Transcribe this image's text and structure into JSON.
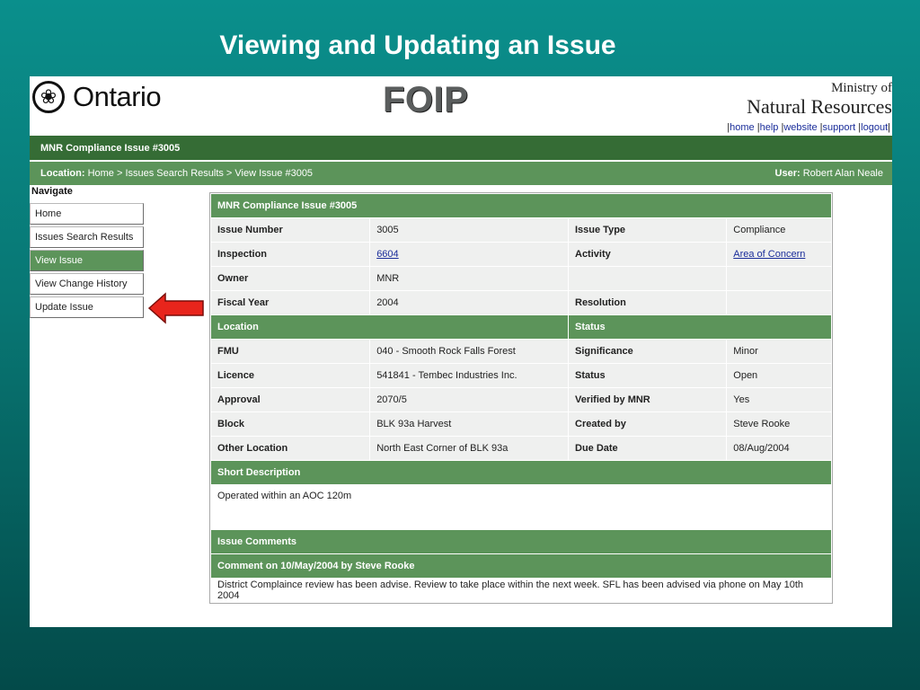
{
  "slide_title": "Viewing and Updating an  Issue",
  "header": {
    "logo_text": "Ontario",
    "app_name": "FOIP",
    "ministry_line1": "Ministry of",
    "ministry_line2": "Natural Resources",
    "links": [
      "home",
      "help",
      "website",
      "support",
      "logout"
    ]
  },
  "title_bar": "MNR Compliance Issue #3005",
  "location_bar": {
    "label": "Location:",
    "path": "Home > Issues Search Results > View Issue #3005",
    "user_label": "User:",
    "user_name": "Robert Alan Neale"
  },
  "nav": {
    "title": "Navigate",
    "items": [
      {
        "label": "Home",
        "active": false
      },
      {
        "label": "Issues Search Results",
        "active": false
      },
      {
        "label": "View Issue",
        "active": true
      },
      {
        "label": "View Change History",
        "active": false
      },
      {
        "label": "Update Issue",
        "active": false
      }
    ]
  },
  "issue": {
    "panel_title": "MNR Compliance Issue #3005",
    "issue_number_label": "Issue Number",
    "issue_number": "3005",
    "issue_type_label": "Issue Type",
    "issue_type": "Compliance",
    "inspection_label": "Inspection",
    "inspection": "6604",
    "activity_label": "Activity",
    "activity": "Area of Concern",
    "owner_label": "Owner",
    "owner": "MNR",
    "fiscal_year_label": "Fiscal Year",
    "fiscal_year": "2004",
    "resolution_label": "Resolution",
    "resolution": "",
    "location_section": "Location",
    "status_section": "Status",
    "fmu_label": "FMU",
    "fmu": "040 - Smooth Rock Falls Forest",
    "significance_label": "Significance",
    "significance": "Minor",
    "licence_label": "Licence",
    "licence": "541841 - Tembec Industries Inc.",
    "status_label": "Status",
    "status": "Open",
    "approval_label": "Approval",
    "approval": "2070/5",
    "verified_label": "Verified by MNR",
    "verified": "Yes",
    "block_label": "Block",
    "block": "BLK 93a Harvest",
    "created_label": "Created by",
    "created": "Steve Rooke",
    "other_location_label": "Other Location",
    "other_location": "North East Corner of BLK 93a",
    "due_date_label": "Due Date",
    "due_date": "08/Aug/2004",
    "short_desc_section": "Short Description",
    "short_desc": "Operated within an AOC 120m",
    "comments_section": "Issue Comments",
    "comment_head": "Comment on 10/May/2004 by Steve Rooke",
    "comment_text": "District Complaince review has been advise. Review to take place within the next week. SFL has been advised via phone on May 10th 2004"
  },
  "colors": {
    "dark_green": "#356c35",
    "green": "#5c945a",
    "arrow_red": "#e8251c"
  }
}
